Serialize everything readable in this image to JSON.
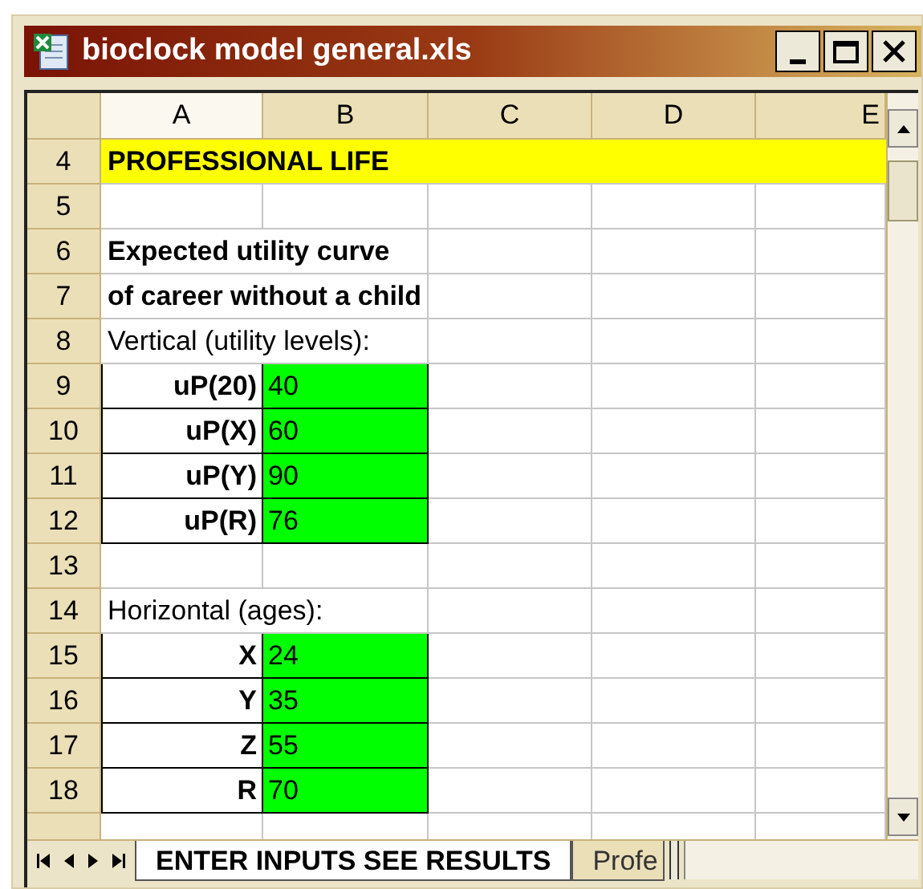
{
  "window": {
    "title": "bioclock model general.xls"
  },
  "columns": [
    {
      "label": "A",
      "selected": true
    },
    {
      "label": "B",
      "selected": false
    },
    {
      "label": "C",
      "selected": false
    },
    {
      "label": "D",
      "selected": false
    },
    {
      "label": "E",
      "selected": false
    }
  ],
  "rows": [
    {
      "number": "4",
      "kind": "title",
      "text": "PROFESSIONAL LIFE"
    },
    {
      "number": "5",
      "kind": "blank"
    },
    {
      "number": "6",
      "kind": "heading",
      "text": "Expected utility curve"
    },
    {
      "number": "7",
      "kind": "heading",
      "text": "of career without a child"
    },
    {
      "number": "8",
      "kind": "note",
      "text": "Vertical (utility levels):"
    },
    {
      "number": "9",
      "kind": "input",
      "label": "uP(20)",
      "value": "40"
    },
    {
      "number": "10",
      "kind": "input",
      "label": "uP(X)",
      "value": "60"
    },
    {
      "number": "11",
      "kind": "input",
      "label": "uP(Y)",
      "value": "90"
    },
    {
      "number": "12",
      "kind": "input",
      "label": "uP(R)",
      "value": "76"
    },
    {
      "number": "13",
      "kind": "blank"
    },
    {
      "number": "14",
      "kind": "note",
      "text": "Horizontal (ages):"
    },
    {
      "number": "15",
      "kind": "input",
      "label": "X",
      "value": "24"
    },
    {
      "number": "16",
      "kind": "input",
      "label": "Y",
      "value": "35"
    },
    {
      "number": "17",
      "kind": "input",
      "label": "Z",
      "value": "55"
    },
    {
      "number": "18",
      "kind": "input",
      "label": "R",
      "value": "70"
    },
    {
      "kind": "blank"
    }
  ],
  "sheet_tabs": [
    {
      "label": "ENTER INPUTS SEE RESULTS",
      "selected": true
    },
    {
      "label": "Profe",
      "selected": false
    }
  ]
}
